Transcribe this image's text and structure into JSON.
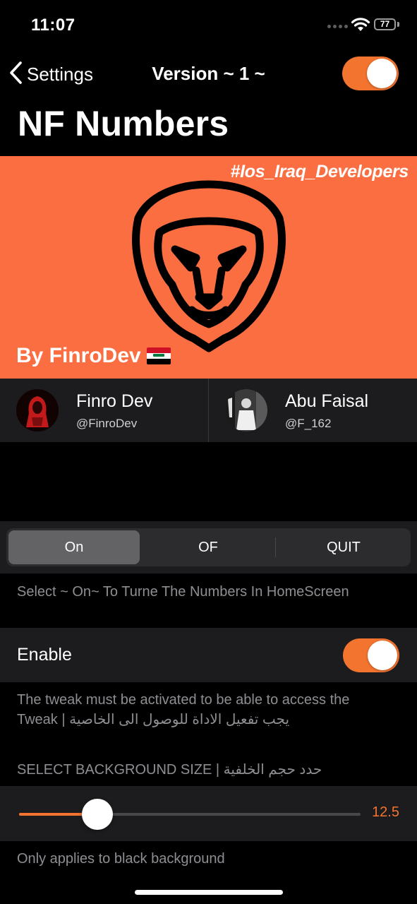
{
  "status_bar": {
    "time": "11:07",
    "battery": "77"
  },
  "nav": {
    "back_label": "Settings",
    "title": "Version ~ 1 ~",
    "toggle_on": true
  },
  "page_title": "NF Numbers",
  "banner": {
    "hashtag": "#Ios_Iraq_Developers",
    "byline": "By FinroDev",
    "logo": "lion-head-icon",
    "flag": "iraq-flag-icon",
    "bg_color": "#fa6e41"
  },
  "developers": [
    {
      "name": "Finro Dev",
      "handle": "@FinroDev"
    },
    {
      "name": "Abu Faisal",
      "handle": "@F_162"
    }
  ],
  "segmented": {
    "options": [
      "On",
      "OF",
      "QUIT"
    ],
    "selected": "On"
  },
  "segmented_footer": "Select ~ On~ To Turne The Numbers In HomeScreen",
  "enable": {
    "label": "Enable",
    "on": true,
    "footer_line1": "The tweak must be activated to be able to access the",
    "footer_line2": "Tweak | يجب تفعيل الاداة للوصول الى الخاصية"
  },
  "background_size": {
    "header": "SELECT BACKGROUND SIZE | حدد حجم الخلفية",
    "value": "12.5",
    "fraction": 0.23,
    "footer": "Only applies to black background"
  },
  "accent_color": "#f3742f"
}
